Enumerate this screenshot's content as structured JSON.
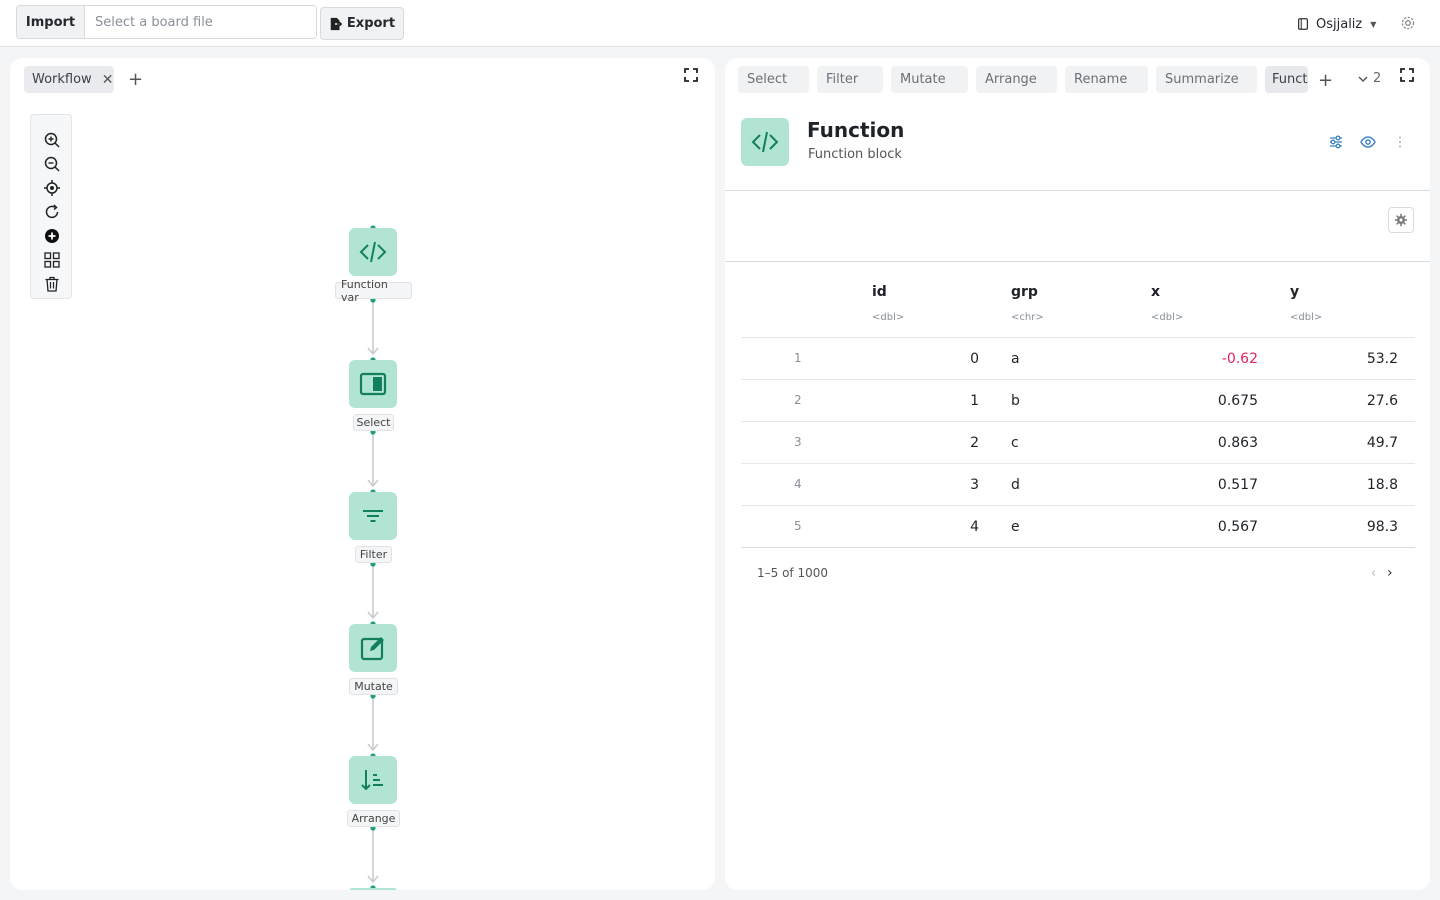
{
  "topbar": {
    "import_label": "Import",
    "file_placeholder": "Select a board file",
    "export_label": "Export",
    "user_name": "Osjjaliz"
  },
  "workspace": {
    "tab_label": "Workflow",
    "tools": [
      "zoom-in-icon",
      "zoom-out-icon",
      "fit-view-icon",
      "refresh-icon",
      "add-block-icon",
      "layout-icon",
      "delete-icon"
    ],
    "nodes": [
      {
        "label": "Function var",
        "icon": "code-icon"
      },
      {
        "label": "Select",
        "icon": "select-columns-icon"
      },
      {
        "label": "Filter",
        "icon": "filter-icon"
      },
      {
        "label": "Mutate",
        "icon": "edit-icon"
      },
      {
        "label": "Arrange",
        "icon": "sort-icon"
      }
    ]
  },
  "detail": {
    "tabs": [
      "Select",
      "Filter",
      "Mutate",
      "Arrange",
      "Rename",
      "Summarize",
      "Functi"
    ],
    "more_count": "2",
    "block_title": "Function",
    "block_subtitle": "Function block",
    "accent": "#2aa58a",
    "columns": [
      {
        "name": "id",
        "type": "<dbl>"
      },
      {
        "name": "grp",
        "type": "<chr>"
      },
      {
        "name": "x",
        "type": "<dbl>"
      },
      {
        "name": "y",
        "type": "<dbl>"
      }
    ],
    "rows": [
      {
        "n": "1",
        "id": "0",
        "grp": "a",
        "x": "-0.62",
        "y": "53.2"
      },
      {
        "n": "2",
        "id": "1",
        "grp": "b",
        "x": "0.675",
        "y": "27.6"
      },
      {
        "n": "3",
        "id": "2",
        "grp": "c",
        "x": "0.863",
        "y": "49.7"
      },
      {
        "n": "4",
        "id": "3",
        "grp": "d",
        "x": "0.517",
        "y": "18.8"
      },
      {
        "n": "5",
        "id": "4",
        "grp": "e",
        "x": "0.567",
        "y": "98.3"
      }
    ],
    "pager_text": "1–5 of 1000"
  }
}
